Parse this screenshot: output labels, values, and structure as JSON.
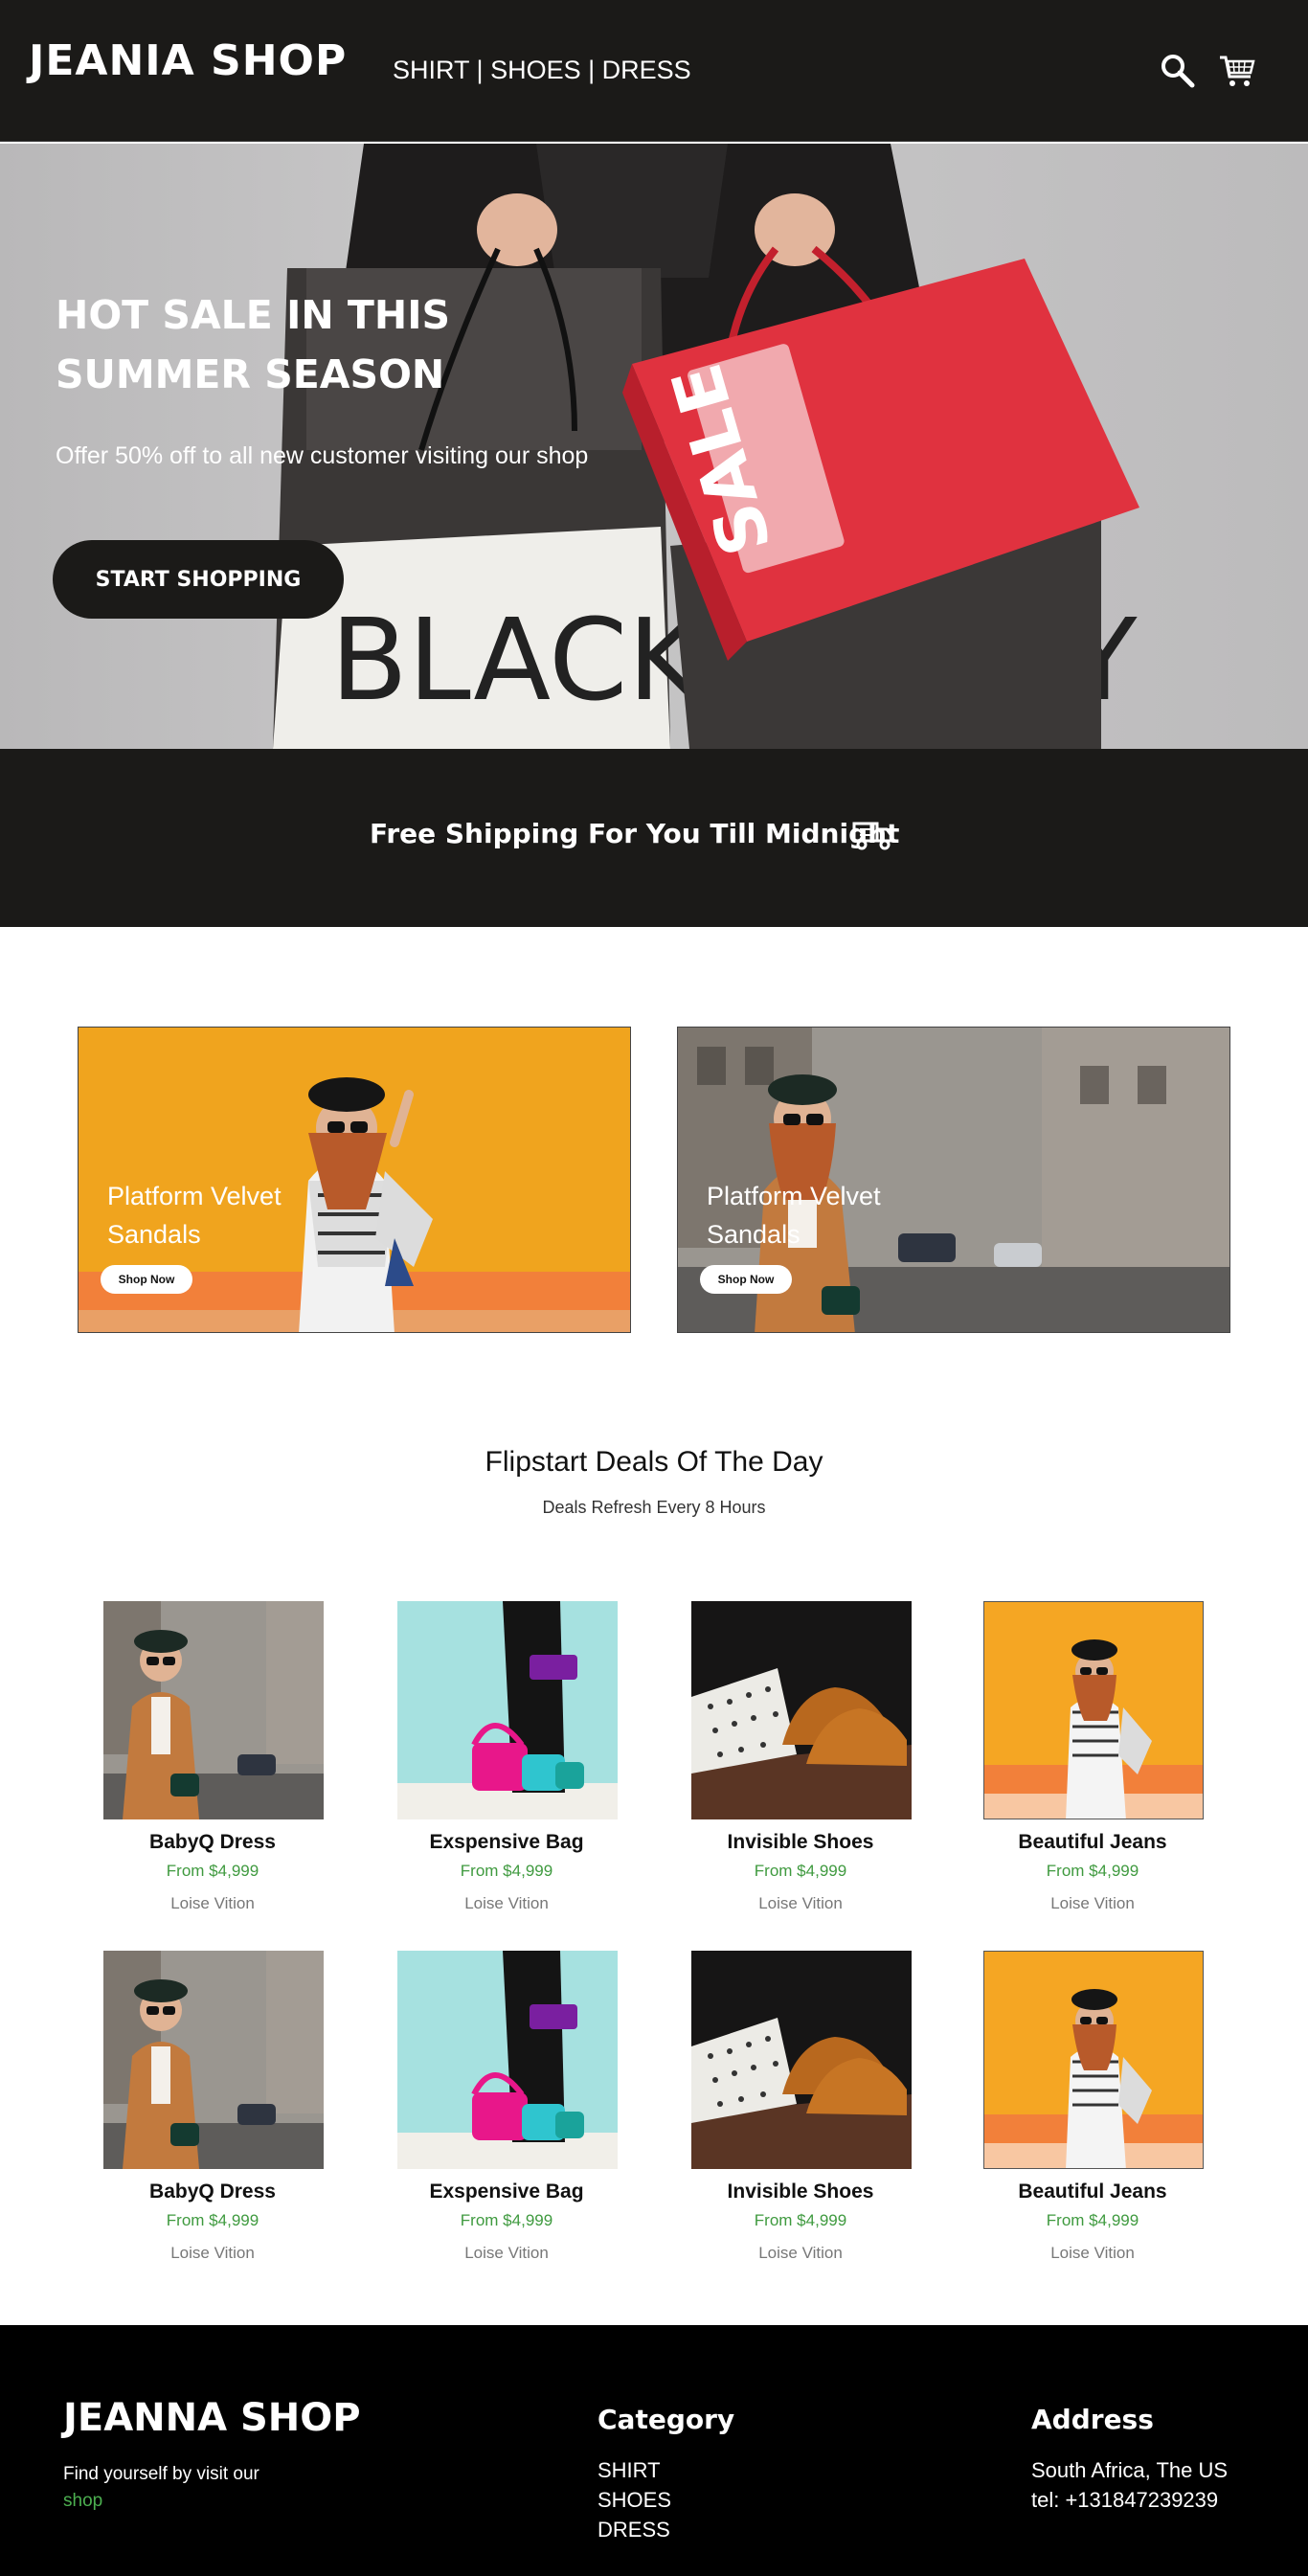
{
  "header": {
    "logo": "JEANIA SHOP",
    "nav": [
      "SHIRT",
      "SHOES",
      "DRESS"
    ],
    "separator": "|"
  },
  "hero": {
    "title": "HOT SALE IN THIS SUMMER SEASON",
    "subtitle": "Offer 50% off to all new customer visiting our shop",
    "button": "START SHOPPING",
    "bag_black_text": "BLACK FRIDAY",
    "bag_sale_text": "SALE"
  },
  "shipping": {
    "text": "Free Shipping For You Till Midnight"
  },
  "promos": [
    {
      "title": "Platform Velvet Sandals",
      "button": "Shop Now"
    },
    {
      "title": "Platform Velvet Sandals",
      "button": "Shop Now"
    }
  ],
  "deals": {
    "title": "Flipstart Deals Of The Day",
    "subtitle": "Deals Refresh Every 8 Hours",
    "products": [
      {
        "name": "BabyQ Dress",
        "price": "From $4,999",
        "brand": "Loise Vition"
      },
      {
        "name": "Exspensive Bag",
        "price": "From $4,999",
        "brand": "Loise Vition"
      },
      {
        "name": "Invisible Shoes",
        "price": "From $4,999",
        "brand": "Loise Vition"
      },
      {
        "name": "Beautiful Jeans",
        "price": "From $4,999",
        "brand": "Loise Vition"
      },
      {
        "name": "BabyQ Dress",
        "price": "From $4,999",
        "brand": "Loise Vition"
      },
      {
        "name": "Exspensive Bag",
        "price": "From $4,999",
        "brand": "Loise Vition"
      },
      {
        "name": "Invisible Shoes",
        "price": "From $4,999",
        "brand": "Loise Vition"
      },
      {
        "name": "Beautiful Jeans",
        "price": "From $4,999",
        "brand": "Loise Vition"
      }
    ]
  },
  "footer": {
    "logo": "JEANNA SHOP",
    "tagline": "Find yourself by visit our",
    "tagline_link": "shop",
    "category_heading": "Category",
    "categories": [
      "SHIRT",
      "SHOES",
      "DRESS"
    ],
    "address_heading": "Address",
    "address_lines": [
      "South Africa, The US",
      "tel: +131847239239"
    ]
  },
  "colors": {
    "dark": "#1b1a18",
    "accent_green": "#3f9a3f",
    "sale_red": "#e0323f"
  },
  "icons": [
    "search-icon",
    "cart-icon",
    "truck-icon"
  ]
}
